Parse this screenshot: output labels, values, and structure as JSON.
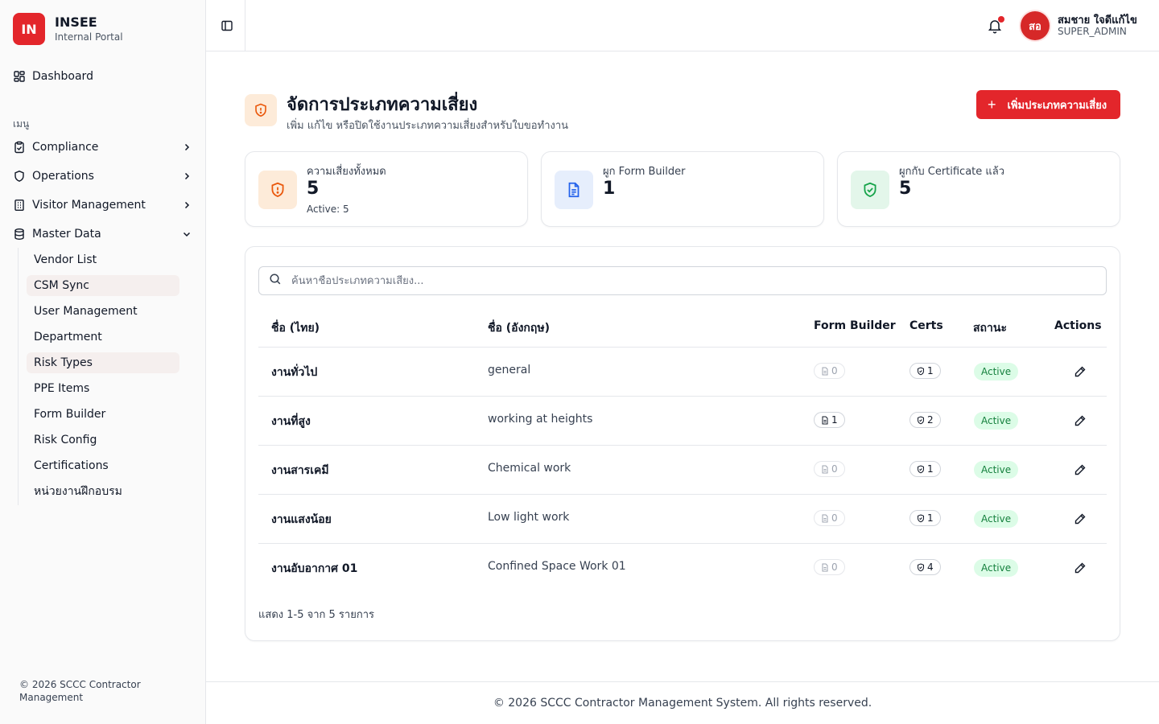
{
  "brand": {
    "logo": "IN",
    "name": "INSEE",
    "subtitle": "Internal Portal"
  },
  "sidebar": {
    "dashboard": "Dashboard",
    "section_label": "เมนู",
    "items": [
      {
        "label": "Compliance",
        "icon": "clipboard-check-icon"
      },
      {
        "label": "Operations",
        "icon": "shield-icon"
      },
      {
        "label": "Visitor Management",
        "icon": "building-icon"
      },
      {
        "label": "Master Data",
        "icon": "database-icon"
      }
    ],
    "master_data_items": [
      "Vendor List",
      "CSM Sync",
      "User Management",
      "Department",
      "Risk Types",
      "PPE Items",
      "Form Builder",
      "Risk Config",
      "Certifications",
      "หน่วยงานฝึกอบรม"
    ],
    "footer": "© 2026 SCCC Contractor Management"
  },
  "header": {
    "avatar_initials": "สอ",
    "user_name": "สมชาย ใจดีแก้ไข",
    "user_role": "SUPER_ADMIN"
  },
  "page": {
    "title": "จัดการประเภทความเสี่ยง",
    "subtitle": "เพิ่ม แก้ไข หรือปิดใช้งานประเภทความเสี่ยงสำหรับใบขอทำงาน",
    "add_button": "เพิ่มประเภทความเสี่ยง"
  },
  "stats": [
    {
      "label": "ความเสี่ยงทั้งหมด",
      "value": "5",
      "extra": "Active: 5",
      "color": "#ea580c"
    },
    {
      "label": "ผูก Form Builder",
      "value": "1",
      "extra": "",
      "color": "#2563eb"
    },
    {
      "label": "ผูกกับ Certificate แล้ว",
      "value": "5",
      "extra": "",
      "color": "#16a34a"
    }
  ],
  "table": {
    "search_placeholder": "ค้นหาชื่อประเภทความเสี่ยง...",
    "headers": {
      "name_th": "ชื่อ (ไทย)",
      "name_en": "ชื่อ (อังกฤษ)",
      "form_builder": "Form Builder",
      "certs": "Certs",
      "status": "สถานะ",
      "actions": "Actions"
    },
    "rows": [
      {
        "name_th": "งานทั่วไป",
        "name_en": "general",
        "form": "0",
        "certs": "1",
        "status": "Active"
      },
      {
        "name_th": "งานที่สูง",
        "name_en": "working at heights",
        "form": "1",
        "certs": "2",
        "status": "Active"
      },
      {
        "name_th": "งานสารเคมี",
        "name_en": "Chemical work",
        "form": "0",
        "certs": "1",
        "status": "Active"
      },
      {
        "name_th": "งานแสงน้อย",
        "name_en": "Low light work",
        "form": "0",
        "certs": "1",
        "status": "Active"
      },
      {
        "name_th": "งานอับอากาศ 01",
        "name_en": "Confined Space Work 01",
        "form": "0",
        "certs": "4",
        "status": "Active"
      }
    ],
    "pagination": "แสดง 1-5 จาก 5 รายการ"
  },
  "footer": "© 2026 SCCC Contractor Management System. All rights reserved."
}
